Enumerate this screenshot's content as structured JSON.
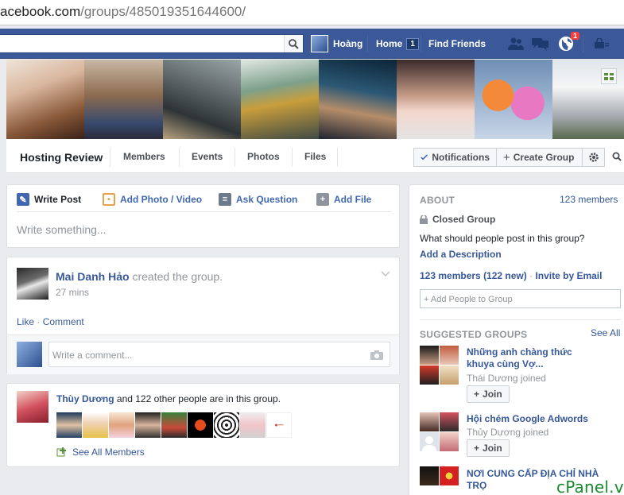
{
  "browser": {
    "url_host": "acebook.com",
    "url_path": "/groups/485019351644600/"
  },
  "topbar": {
    "user_name": "Hoàng",
    "home_label": "Home",
    "home_count": "1",
    "find_friends": "Find Friends",
    "notif_count": "1"
  },
  "group": {
    "name": "Hosting Review",
    "tabs": [
      "Members",
      "Events",
      "Photos",
      "Files"
    ],
    "notifications_label": "Notifications",
    "create_group_label": "Create Group"
  },
  "composer": {
    "tabs": [
      "Write Post",
      "Add Photo / Video",
      "Ask Question",
      "Add File"
    ],
    "placeholder": "Write something..."
  },
  "post": {
    "author": "Mai Danh Hảo",
    "action": "created the group.",
    "time": "27 mins",
    "like": "Like",
    "comment": "Comment",
    "comment_placeholder": "Write a comment..."
  },
  "members_card": {
    "first": "Thùy Dương",
    "rest": "and 122 other people are in this group.",
    "see_all": "See All Members"
  },
  "about": {
    "header": "ABOUT",
    "members": "123 members",
    "privacy": "Closed Group",
    "question": "What should people post in this group?",
    "add_desc": "Add a Description",
    "members_new": "123 members",
    "new_count": "(122 new)",
    "invite": "Invite by Email",
    "add_people_placeholder": "+ Add People to Group"
  },
  "suggested": {
    "header": "SUGGESTED GROUPS",
    "see_all": "See All",
    "join_label": "Join",
    "groups": [
      {
        "name": "Những anh chàng thức khuya cùng Vợ...",
        "joined": "Thái Dương joined"
      },
      {
        "name": "Hội chém Google Adwords",
        "joined": "Thủy Dương joined"
      },
      {
        "name": "NƠI CUNG CẤP ĐỊA CHỈ NHÀ TRỌ",
        "joined": ""
      }
    ]
  },
  "watermark": "cPanel.vn",
  "colors": {
    "brand": "#3b5998",
    "link": "#365899",
    "accent": "#4267b2"
  }
}
